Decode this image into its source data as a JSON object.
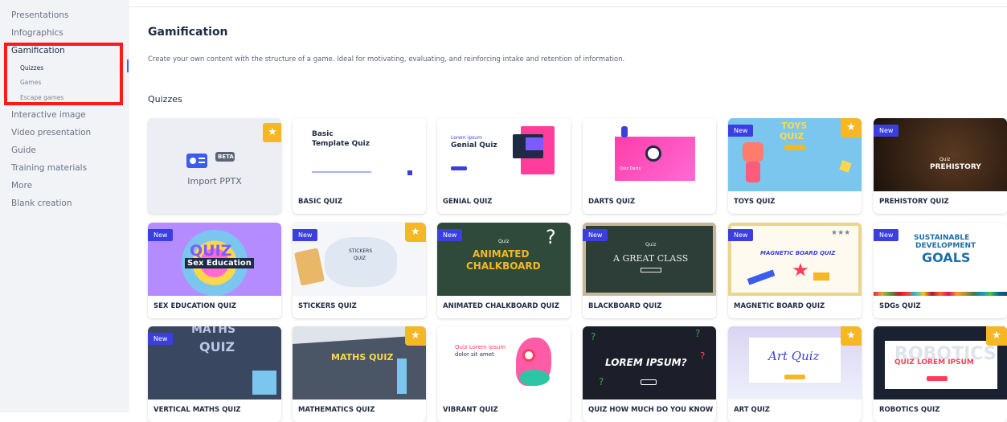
{
  "sidebar": {
    "items": [
      {
        "label": "Presentations"
      },
      {
        "label": "Infographics"
      },
      {
        "label": "Gamification"
      },
      {
        "label": "Quizzes"
      },
      {
        "label": "Games"
      },
      {
        "label": "Escape games"
      },
      {
        "label": "Interactive image"
      },
      {
        "label": "Video presentation"
      },
      {
        "label": "Guide"
      },
      {
        "label": "Training materials"
      },
      {
        "label": "More"
      },
      {
        "label": "Blank creation"
      }
    ]
  },
  "main": {
    "title": "Gamification",
    "description": "Create your own content with the structure of a game. Ideal for motivating, evaluating, and reinforcing intake and retention of information.",
    "section_title": "Quizzes",
    "badge_new": "New",
    "import_card": {
      "label": "Import PPTX",
      "beta": "BETA"
    },
    "cards": [
      {
        "title": "BASIC QUIZ",
        "thumb_title": "Basic",
        "thumb_sub": "Template Quiz"
      },
      {
        "title": "GENIAL QUIZ",
        "thumb_title": "Genial Quiz",
        "thumb_lorem": "Lorem ipsum"
      },
      {
        "title": "DARTS QUIZ",
        "thumb_text": "Quiz Darts"
      },
      {
        "title": "TOYS QUIZ",
        "thumb_title": "TOYS",
        "thumb_sub": "QUIZ"
      },
      {
        "title": "PREHISTORY QUIZ",
        "thumb_title": "PREHISTORY",
        "thumb_sub": "Quiz"
      },
      {
        "title": "SEX EDUCATION QUIZ",
        "thumb_title": "QUIZ",
        "thumb_sub": "Sex Education"
      },
      {
        "title": "STICKERS QUIZ",
        "thumb_title": "STICKERS",
        "thumb_sub": "QUIZ"
      },
      {
        "title": "ANIMATED CHALKBOARD QUIZ",
        "thumb_title": "ANIMATED",
        "thumb_sub": "CHALKBOARD",
        "thumb_small": "Quiz"
      },
      {
        "title": "BLACKBOARD QUIZ",
        "thumb_title": "A GREAT CLASS",
        "thumb_small": "Quiz"
      },
      {
        "title": "MAGNETIC BOARD QUIZ",
        "thumb_title": "MAGNETIC BOARD QUIZ"
      },
      {
        "title": "SDGs QUIZ",
        "thumb_title": "SUSTAINABLE",
        "thumb_sub": "DEVELOPMENT",
        "thumb_goals": "GOALS"
      },
      {
        "title": "VERTICAL MATHS QUIZ",
        "thumb_title": "MATHS",
        "thumb_sub": "QUIZ"
      },
      {
        "title": "MATHEMATICS QUIZ",
        "thumb_title": "MATHS QUIZ"
      },
      {
        "title": "VIBRANT QUIZ",
        "thumb_title": "Quiz Lorem ipsum",
        "thumb_sub": "dolor sit amet"
      },
      {
        "title": "QUIZ HOW MUCH DO YOU KNOW",
        "thumb_title": "LOREM IPSUM?"
      },
      {
        "title": "ART QUIZ",
        "thumb_title": "Art Quiz"
      },
      {
        "title": "ROBOTICS QUIZ",
        "thumb_title": "QUIZ LOREM IPSUM",
        "thumb_bg": "ROBOTICS"
      }
    ]
  },
  "colors": {
    "accent": "#3b3fe0",
    "star": "#f5b724",
    "highlight": "#ff1a1a"
  }
}
